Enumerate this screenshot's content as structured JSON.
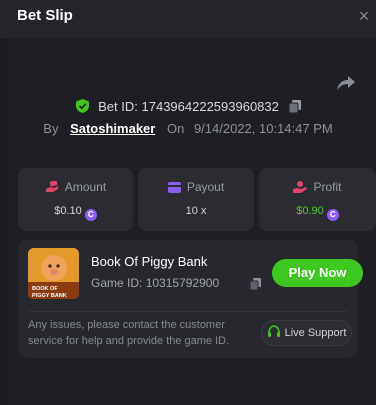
{
  "header": {
    "title": "Bet Slip",
    "close_symbol": "×"
  },
  "bet": {
    "id_label": "Bet ID:",
    "id": "1743964222593960832",
    "by_label": "By",
    "user": "Satoshimaker",
    "on_label": "On",
    "datetime": "9/14/2022, 10:14:47 PM"
  },
  "stats": {
    "amount": {
      "label": "Amount",
      "value": "$0.10"
    },
    "payout": {
      "label": "Payout",
      "value": "10 x"
    },
    "profit": {
      "label": "Profit",
      "value": "$0.90"
    }
  },
  "game": {
    "name": "Book Of Piggy Bank",
    "id_label": "Game ID:",
    "id": "10315792900",
    "thumb_text": "BOOK OF PIGGY BANK",
    "play_label": "Play Now",
    "issues_text": "Any issues, please contact the customer service for help and provide the game ID.",
    "support_label": "Live Support"
  },
  "colors": {
    "accent_green": "#3dc720",
    "profit_green": "#4ccf2a",
    "coin_purple": "#8b5cf6",
    "amount_icon": "#e0446a",
    "payout_icon": "#8b5cf6",
    "profit_icon": "#e0446a"
  },
  "icons": {
    "close": "close-icon",
    "share": "share-icon",
    "shield": "shield-check-icon",
    "copy": "copy-icon",
    "amount": "money-hand-icon",
    "payout": "wallet-icon",
    "profit": "coin-hand-icon",
    "coin": "coin-icon",
    "support": "headset-icon"
  }
}
